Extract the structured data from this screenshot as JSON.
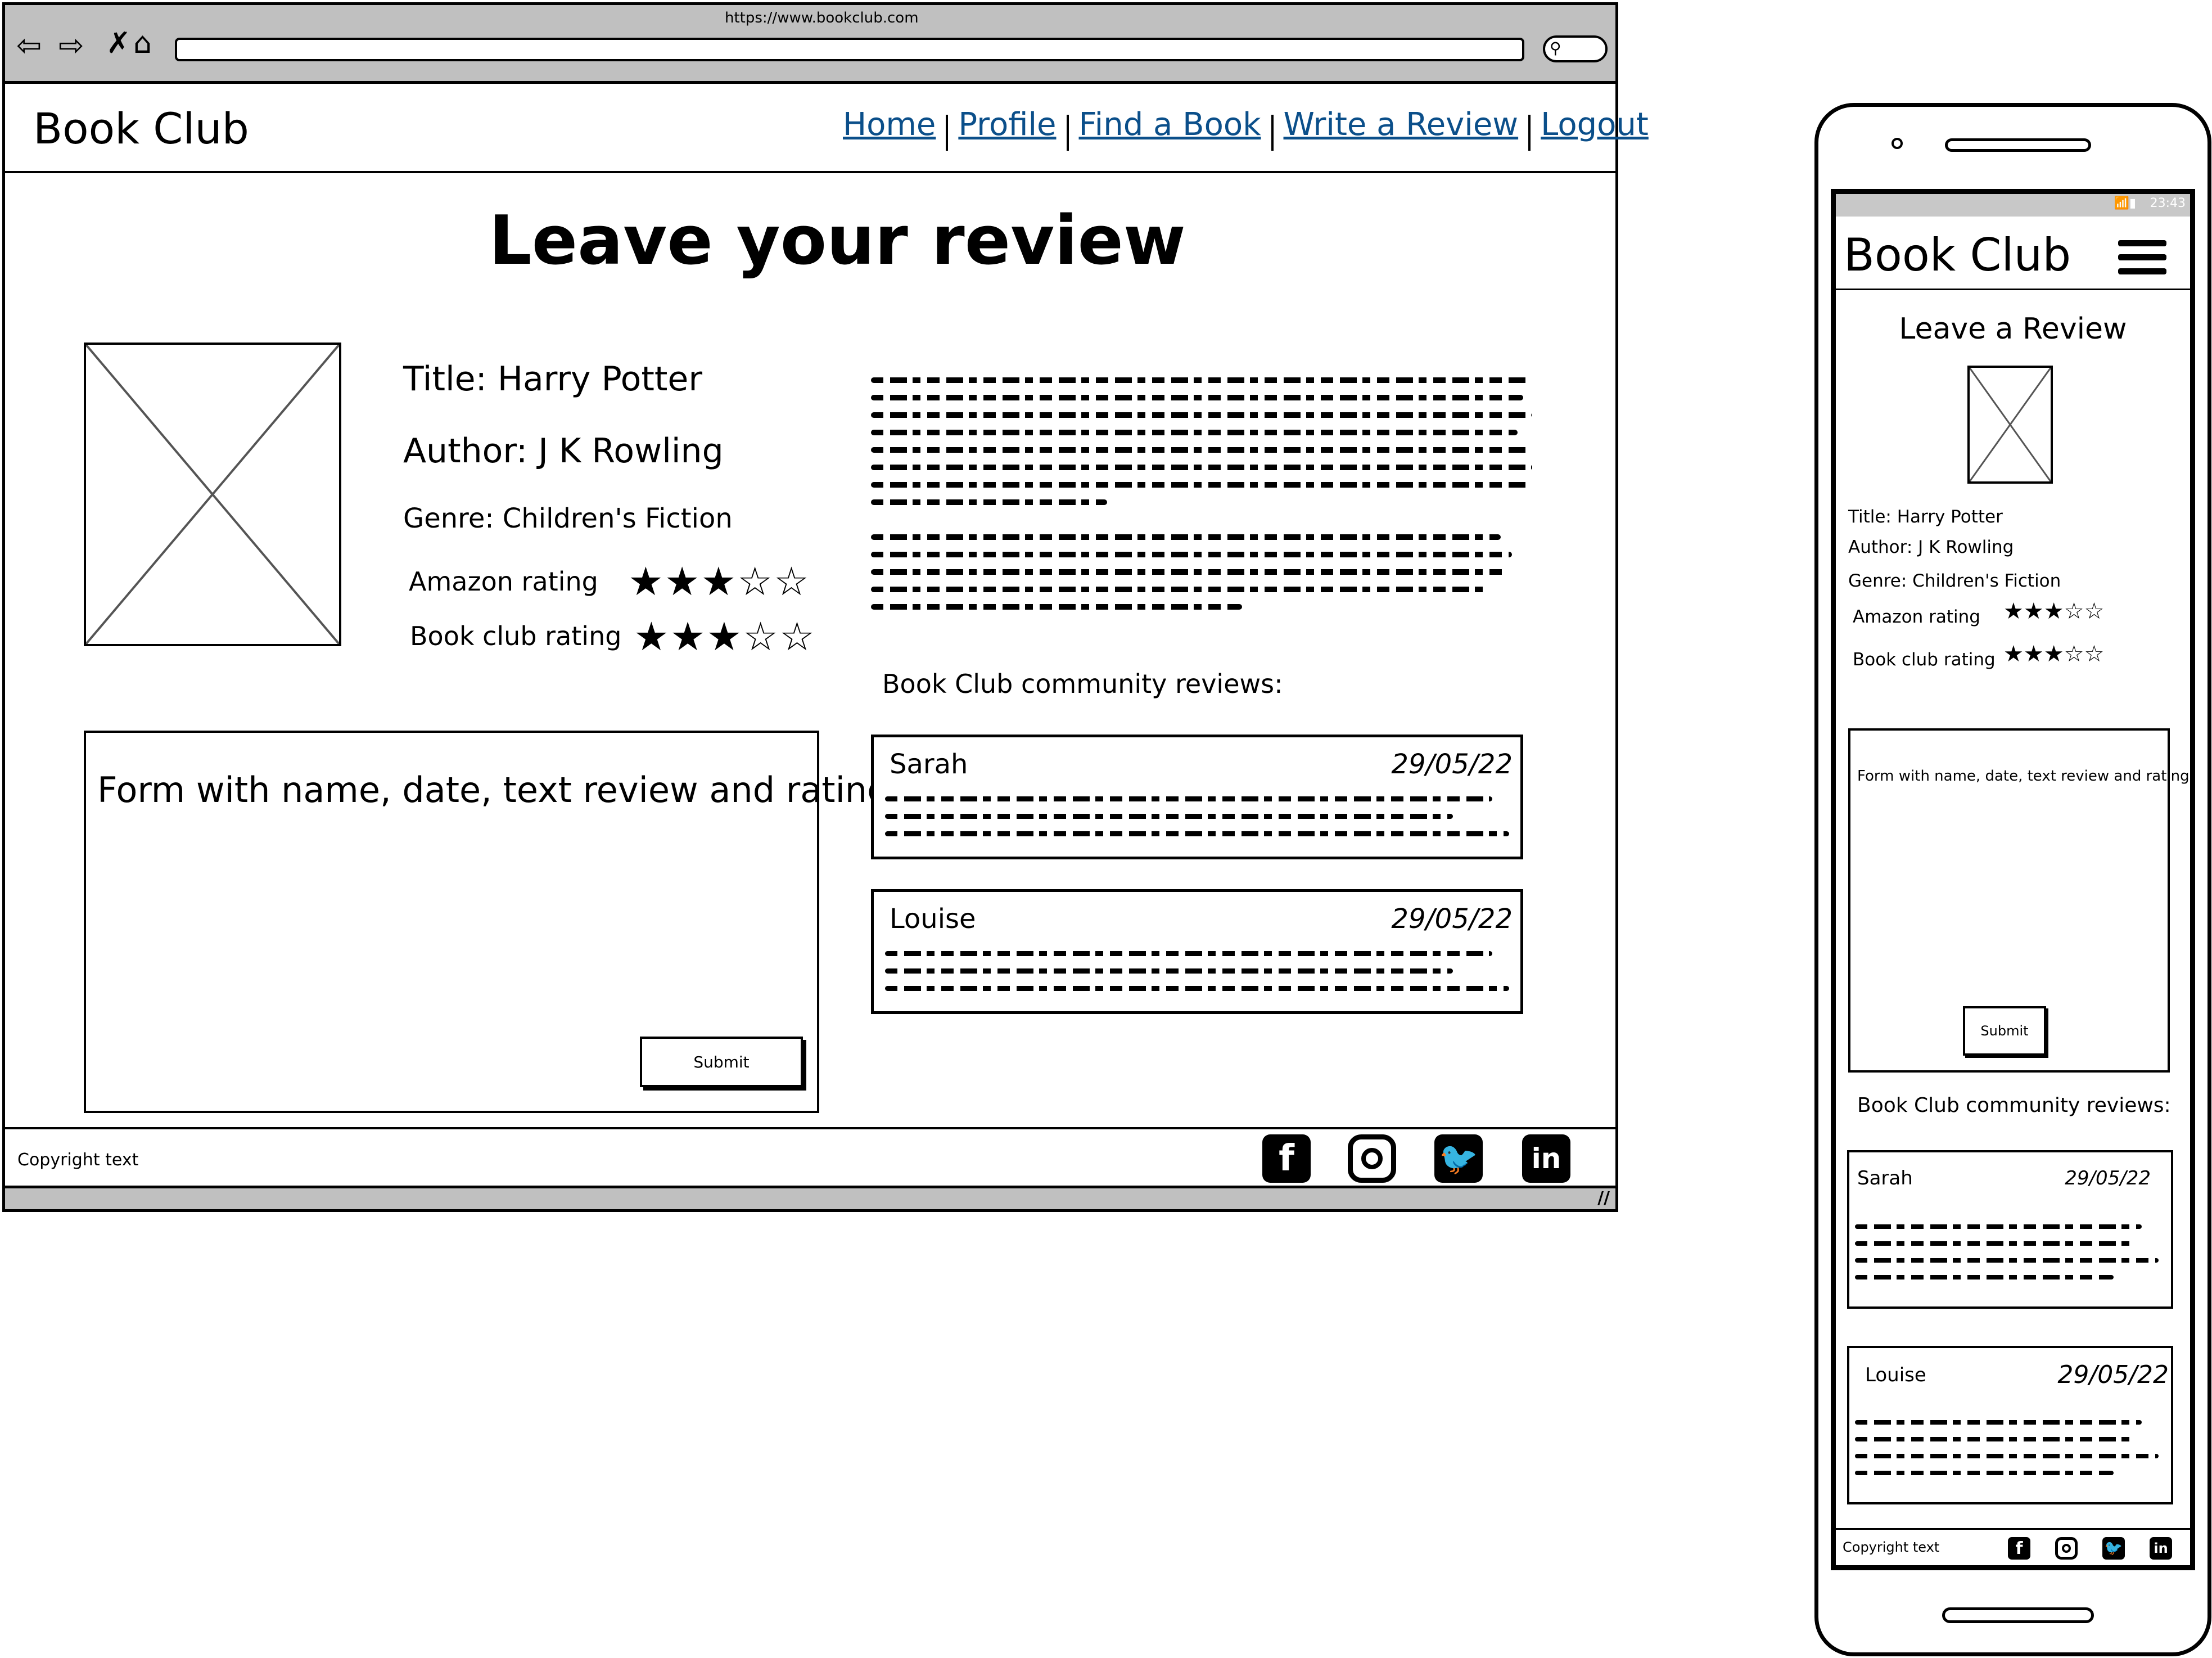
{
  "browser": {
    "url": "https://www.bookclub.com"
  },
  "site": {
    "brand": "Book Club"
  },
  "nav": [
    "Home",
    "Profile",
    "Find a Book",
    "Write a Review",
    "Logout"
  ],
  "page": {
    "heading": "Leave your review"
  },
  "book": {
    "title": "Title: Harry Potter",
    "author": "Author: J K Rowling",
    "genre": "Genre: Children's Fiction",
    "amazon_label": "Amazon rating",
    "amazon_rating": 3,
    "bookclub_label": "Book club rating",
    "bookclub_rating": 3,
    "rating_max": 5
  },
  "form": {
    "placeholder": "Form with name, date, text review and rating",
    "submit": "Submit"
  },
  "community": {
    "heading": "Book Club community reviews:",
    "reviews": [
      {
        "name": "Sarah",
        "date": "29/05/22"
      },
      {
        "name": "Louise",
        "date": "29/05/22"
      }
    ]
  },
  "footer": {
    "copyright": "Copyright text"
  },
  "social_icons": [
    "facebook-icon",
    "instagram-icon",
    "twitter-icon",
    "linkedin-icon"
  ],
  "mobile": {
    "status_time": "23:43",
    "brand": "Book Club",
    "heading": "Leave a Review",
    "title": "Title: Harry Potter",
    "author": "Author: J K Rowling",
    "genre": "Genre: Children's Fiction",
    "amazon_label": "Amazon rating",
    "bookclub_label": "Book club rating",
    "form_placeholder": "Form with name, date, text review and rating",
    "submit": "Submit",
    "community_heading": "Book Club community reviews:",
    "reviews": [
      {
        "name": "Sarah",
        "date": "29/05/22"
      },
      {
        "name": "Louise",
        "date": "29/05/22"
      }
    ],
    "copyright": "Copyright text"
  }
}
